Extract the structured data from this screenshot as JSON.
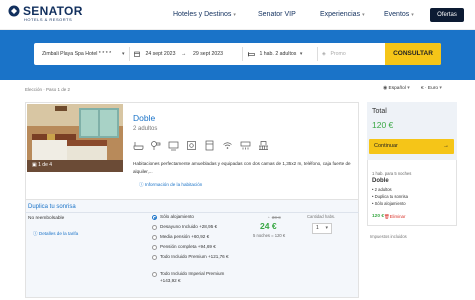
{
  "header": {
    "brand": "SENATOR",
    "brand_sub": "HOTELS & RESORTS",
    "nav": [
      {
        "label": "Hoteles y Destinos",
        "dropdown": true
      },
      {
        "label": "Senator VIP",
        "dropdown": false
      },
      {
        "label": "Experiencias",
        "dropdown": true
      },
      {
        "label": "Eventos",
        "dropdown": true
      }
    ],
    "offers_label": "Ofertas"
  },
  "search": {
    "hotel": "Zimbali Playa Spa Hotel * * * *",
    "checkin": "24 sept 2023",
    "checkout": "29 sept 2023",
    "occupancy": "1 hab. 2 adultos",
    "promo_placeholder": "Promo",
    "submit_label": "CONSULTAR"
  },
  "breadcrumb": "Elección · Paso 1 de 2",
  "language": "Español",
  "currency": "€ · Euro",
  "room": {
    "name": "Doble",
    "guests": "2 adultos",
    "photo_counter": "1 de 4",
    "description": "Habitaciones perfectamente amuebladas y equipadas con dos camas de 1,35x2 m, teléfono, caja fuerte de alquiler,...",
    "info_link": "Información de la habitación",
    "amenity_icons": [
      "bathtub-icon",
      "hairdryer-icon",
      "tv-icon",
      "safe-icon",
      "minibar-icon",
      "wifi-icon",
      "ac-icon",
      "balcony-icon"
    ]
  },
  "rates": {
    "header": "Duplica tu sonrisa",
    "non_refundable": "No reembolsable",
    "details_link": "Detalles de la tarifa",
    "options": [
      {
        "label": "Sólo alojamiento",
        "selected": true
      },
      {
        "label": "Desayuno Incluido +28,95 €",
        "selected": false
      },
      {
        "label": "Media pensión +60,92 €",
        "selected": false
      },
      {
        "label": "Pensión completa +94,69 €",
        "selected": false
      },
      {
        "label": "Todo Incluido Premium +121,76 €",
        "selected": false
      },
      {
        "label": "Todo Incluido Imperial Premium +143,92 €",
        "selected": false
      }
    ],
    "old_price": "30 €",
    "price": "24 €",
    "nights_note": "5 noches = 120 €",
    "qty_label": "Cantidad habs.",
    "qty_value": "1"
  },
  "summary": {
    "total_label": "Total",
    "total_amount": "120 €",
    "continue_label": "Continuar",
    "nights": "1 hab. para 5 noches",
    "room_name": "Doble",
    "items": [
      "2 adultos",
      "Duplica tu sonrisa",
      "Sólo alojamiento"
    ],
    "line_price": "120 €",
    "delete_label": "Eliminar",
    "taxes_note": "Impuestos incluidos"
  },
  "colors": {
    "brand_blue": "#1a73c8",
    "accent_yellow": "#f5c518",
    "price_green": "#3aa845",
    "navy": "#12305e"
  }
}
